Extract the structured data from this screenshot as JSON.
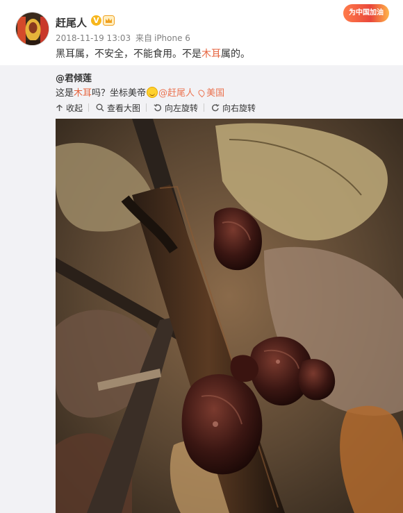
{
  "post": {
    "author": "赶尾人",
    "verified_badge": "V",
    "timestamp": "2018-11-19 13:03",
    "source_prefix": "来自",
    "source": "iPhone 6",
    "campaign_badge": "为中国加油",
    "text_part1": "黑耳属，不安全，不能食用。不是",
    "text_highlight": "木耳",
    "text_part2": "属的。"
  },
  "repost": {
    "author": "@君倾莲",
    "text_part1": "这是",
    "text_highlight": "木耳",
    "text_part2": "吗？坐标美帝",
    "mention": "@赶尾人",
    "location": "美国"
  },
  "toolbar": {
    "collect": "收起",
    "view_large": "查看大图",
    "rotate_left": "向左旋转",
    "rotate_right": "向右旋转"
  },
  "colors": {
    "accent": "#eb7350",
    "badge": "#f7b61c",
    "repost_bg": "#f2f2f5"
  }
}
